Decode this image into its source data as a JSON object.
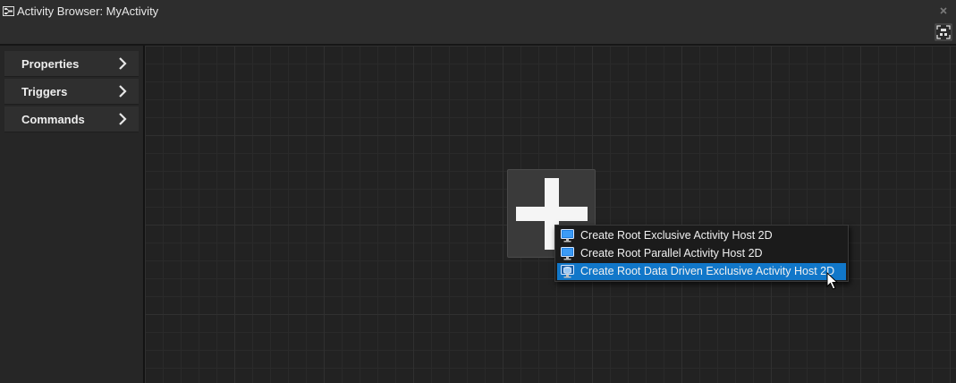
{
  "window": {
    "title": "Activity Browser: MyActivity",
    "icon": "activity-browser-icon",
    "close_icon": "close-icon",
    "zoom_icon": "zoom-to-fit-icon"
  },
  "sidebar": {
    "items": [
      {
        "label": "Properties",
        "icon": "chevron-right-icon"
      },
      {
        "label": "Triggers",
        "icon": "chevron-right-icon"
      },
      {
        "label": "Commands",
        "icon": "chevron-right-icon"
      }
    ]
  },
  "canvas": {
    "add_icon": "plus-icon"
  },
  "context_menu": {
    "items": [
      {
        "label": "Create Root Exclusive Activity Host 2D",
        "icon": "monitor-icon",
        "selected": false
      },
      {
        "label": "Create Root Parallel Activity Host 2D",
        "icon": "monitor-icon",
        "selected": false
      },
      {
        "label": "Create Root Data Driven Exclusive Activity Host 2D",
        "icon": "data-driven-host-icon",
        "selected": true
      }
    ]
  },
  "colors": {
    "background": "#1e1e1e",
    "panel": "#2d2d2d",
    "selection": "#1177c9",
    "text": "#e6e6e6"
  }
}
